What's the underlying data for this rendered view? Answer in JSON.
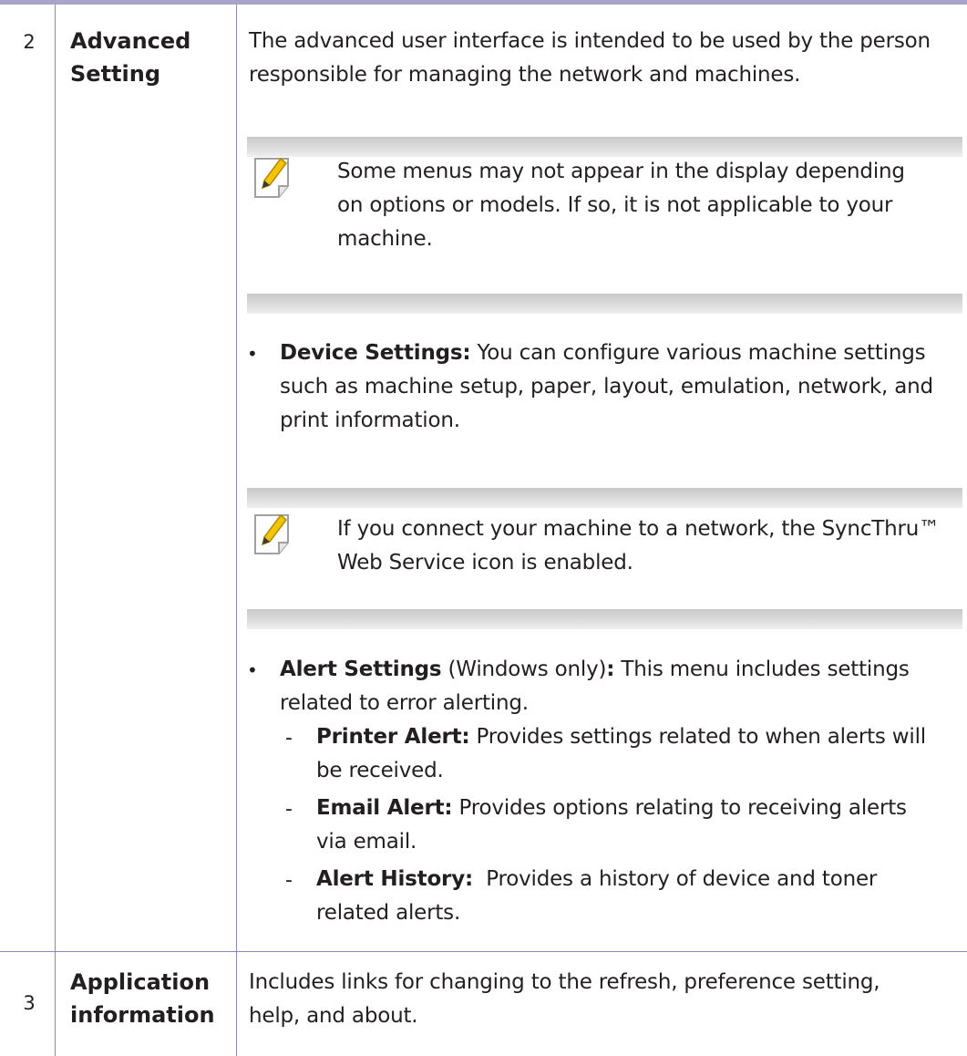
{
  "rows": [
    {
      "number": "2",
      "name": [
        "Advanced",
        "Setting"
      ],
      "intro": [
        "The advanced user interface is intended to be used by the person",
        "responsible for managing the network and machines."
      ],
      "note1": [
        "Some menus may not appear in the display depending",
        "on options or models. If so, it is not applicable to your",
        "machine."
      ],
      "device_settings": {
        "label": "Device Settings:",
        "lines": [
          " You can configure various machine settings",
          "such as machine setup, paper, layout, emulation, network, and",
          "print information."
        ]
      },
      "note2": [
        "If you connect your machine to a network, the SyncThru™",
        "Web Service icon is enabled."
      ],
      "alert_settings": {
        "label": "Alert Settings",
        "qualifier": " (Windows only)",
        "colon": ":",
        "lines": [
          " This menu includes settings",
          "related to error alerting."
        ],
        "items": [
          {
            "label": "Printer Alert:",
            "lines": [
              " Provides settings related to when alerts will",
              "be received."
            ]
          },
          {
            "label": "Email Alert:",
            "lines": [
              " Provides options relating to receiving alerts",
              "via email."
            ]
          },
          {
            "label": "Alert History:",
            "lines": [
              "  Provides a history of device and toner",
              "related alerts."
            ]
          }
        ]
      }
    },
    {
      "number": "3",
      "name": [
        "Application",
        "information"
      ],
      "description": [
        "Includes links for changing to the refresh, preference setting,",
        "help, and about."
      ]
    }
  ],
  "symbols": {
    "bullet": "•",
    "dash": "-"
  },
  "icons": {
    "note": "note-pencil-icon"
  },
  "colors": {
    "rule": "#8e88b8",
    "top_rule": "#a9a4c9",
    "pencil": "#f5c400"
  }
}
